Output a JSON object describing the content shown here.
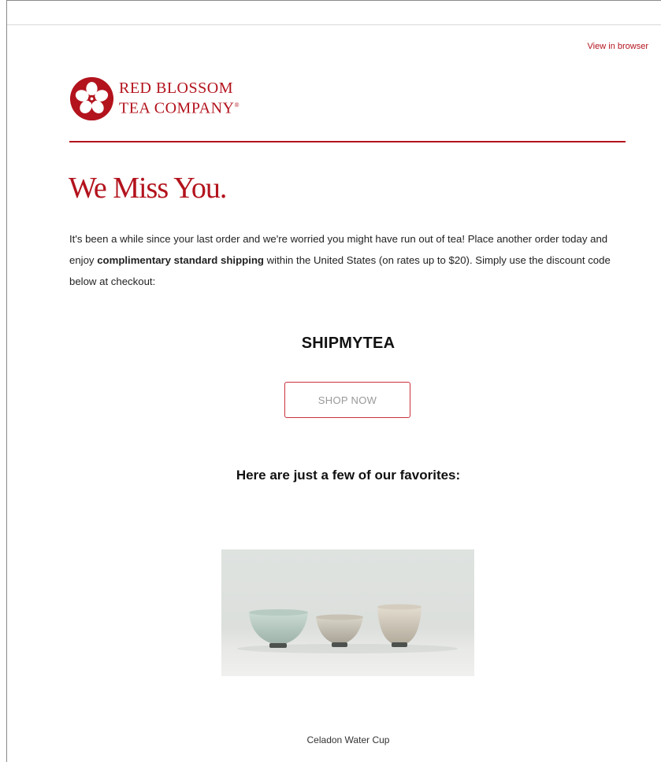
{
  "header": {
    "view_in_browser": "View in browser"
  },
  "brand": {
    "logo_line1": "RED BLOSSOM",
    "logo_line2": "TEA COMPANY",
    "logo_mark": "®",
    "accent_color": "#b3131d"
  },
  "main": {
    "headline": "We Miss You.",
    "paragraph_part1": "It's been a while since your last order and we're worried you might have run out of tea! Place another order today and enjoy ",
    "paragraph_bold": "complimentary standard shipping",
    "paragraph_part2": " within the United States (on rates up to $20). Simply use the discount code below at checkout:",
    "discount_code": "SHIPMYTEA",
    "shop_button": "SHOP NOW",
    "favorites_heading": "Here are just a few of our favorites:"
  },
  "products": [
    {
      "name": "Celadon Water Cup",
      "image_icon": "tea-cups-image"
    }
  ]
}
